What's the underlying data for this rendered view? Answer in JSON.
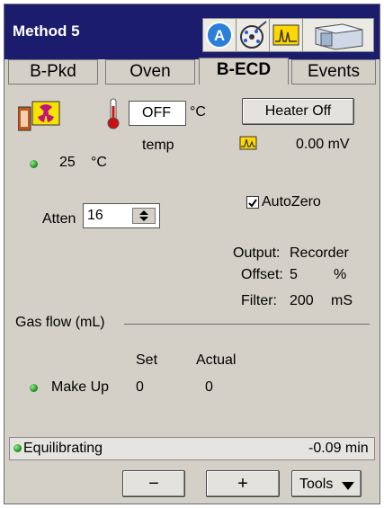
{
  "header": {
    "title": "Method 5"
  },
  "tabs": [
    {
      "label": "B-Pkd"
    },
    {
      "label": "Oven"
    },
    {
      "label": "B-ECD"
    },
    {
      "label": "Events"
    }
  ],
  "detector": {
    "temp_setpoint": "OFF",
    "temp_unit": "°C",
    "temp_label": "temp",
    "actual_temp": "25",
    "actual_temp_unit": "°C",
    "heater_button": "Heater Off",
    "signal_value": "0.00 mV",
    "atten_label": "Atten",
    "atten_value": "16",
    "autozero_label": "AutoZero",
    "autozero_checked": true,
    "output_label": "Output:",
    "output_value": "Recorder",
    "offset_label": "Offset:",
    "offset_value": "5",
    "offset_unit": "%",
    "filter_label": "Filter:",
    "filter_value": "200",
    "filter_unit": "mS"
  },
  "gas": {
    "section_label": "Gas flow (mL)",
    "col_set": "Set",
    "col_actual": "Actual",
    "rows": [
      {
        "name": "Make Up",
        "set": "0",
        "actual": "0"
      }
    ]
  },
  "status": {
    "text": "Equilibrating",
    "time": "-0.09 min"
  },
  "toolbar": {
    "minus_label": "−",
    "plus_label": "+",
    "tools_label": "Tools"
  },
  "colors": {
    "titlebar": "#1c1c6e",
    "panel": "#d4d0c8",
    "led": "#1f9a1f",
    "radiation": "#c0157a"
  }
}
